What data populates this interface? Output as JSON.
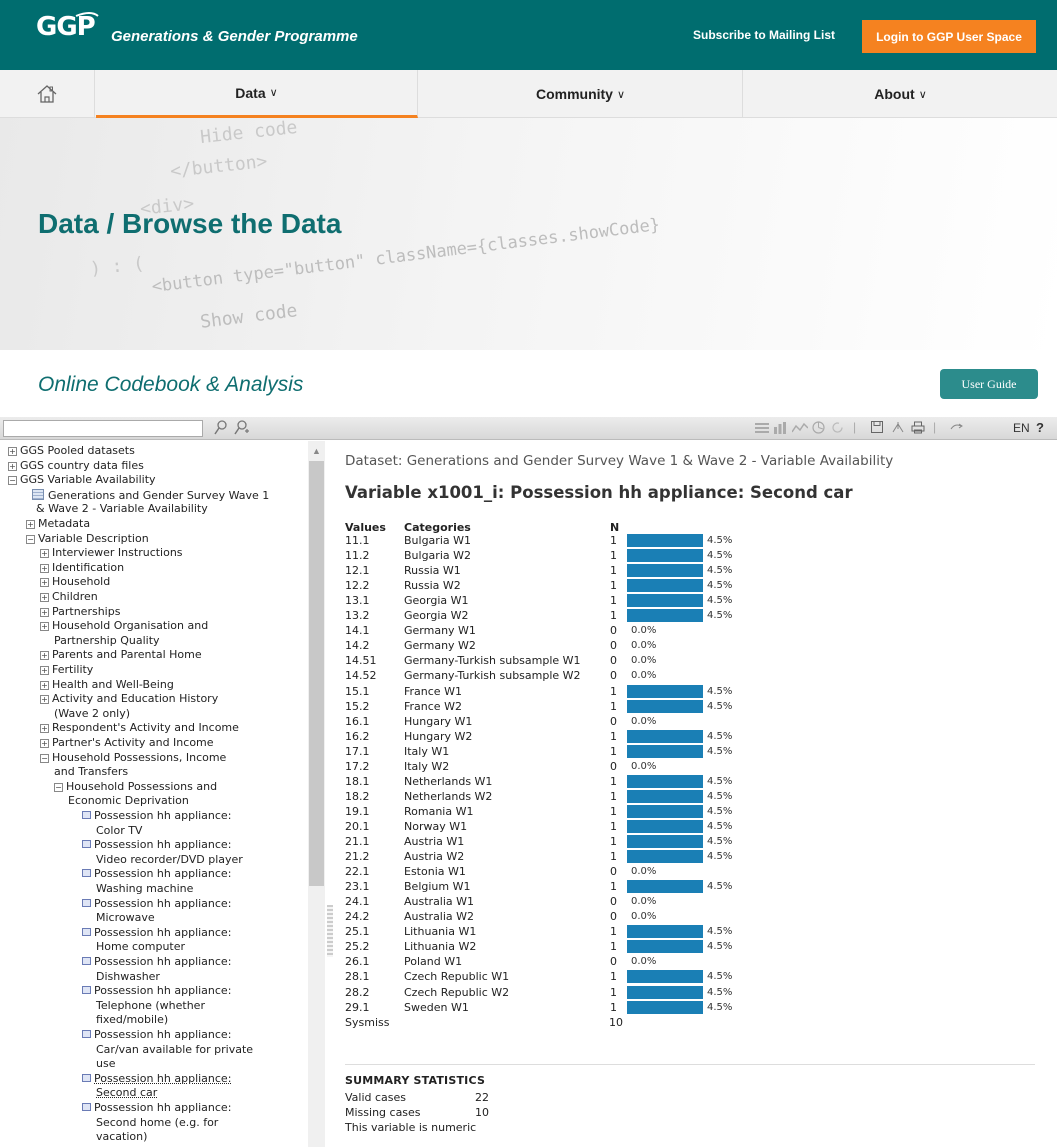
{
  "header": {
    "logo_text": "GGP",
    "brand": "Generations & Gender Programme",
    "subscribe_link": "Subscribe to Mailing List",
    "login_button": "Login to GGP User Space",
    "colors": {
      "teal": "#006d6f",
      "orange": "#f58220"
    }
  },
  "nav": {
    "home_icon": "home-icon",
    "items": [
      {
        "label": "Data",
        "active": true
      },
      {
        "label": "Community",
        "active": false
      },
      {
        "label": "About",
        "active": false
      }
    ],
    "chevron": "∨"
  },
  "hero": {
    "title": "Data / Browse the Data",
    "bg_code": [
      "Hide code",
      "</button>",
      "<div>",
      "<button type=\"button\" className={classes.showCode}",
      "Show code",
      ") : ("
    ]
  },
  "codebook": {
    "title": "Online Codebook & Analysis",
    "user_guide": "User Guide"
  },
  "toolbar": {
    "search_placeholder": "",
    "lang": "EN",
    "help": "?"
  },
  "tree": {
    "expanded_symbol": "−",
    "collapsed_symbol": "+",
    "items": [
      {
        "label": "GGS Pooled datasets",
        "kind": "box",
        "state": "+"
      },
      {
        "label": "GGS country data files",
        "kind": "box",
        "state": "+"
      },
      {
        "label": "GGS Variable Availability",
        "kind": "box",
        "state": "−"
      },
      {
        "label": "Generations and Gender Survey Wave 1",
        "kind": "dataset"
      },
      {
        "label": "& Wave 2 - Variable Availability",
        "kind": "cont"
      },
      {
        "label": "Metadata",
        "kind": "box",
        "state": "+"
      },
      {
        "label": "Variable Description",
        "kind": "box",
        "state": "−"
      },
      {
        "label": "Interviewer Instructions",
        "kind": "box",
        "state": "+"
      },
      {
        "label": "Identification",
        "kind": "box",
        "state": "+"
      },
      {
        "label": "Household",
        "kind": "box",
        "state": "+"
      },
      {
        "label": "Children",
        "kind": "box",
        "state": "+"
      },
      {
        "label": "Partnerships",
        "kind": "box",
        "state": "+"
      },
      {
        "label": "Household Organisation and",
        "kind": "box",
        "state": "+"
      },
      {
        "label": "Partnership Quality",
        "kind": "cont"
      },
      {
        "label": "Parents and Parental Home",
        "kind": "box",
        "state": "+"
      },
      {
        "label": "Fertility",
        "kind": "box",
        "state": "+"
      },
      {
        "label": "Health and Well-Being",
        "kind": "box",
        "state": "+"
      },
      {
        "label": "Activity and Education History",
        "kind": "box",
        "state": "+"
      },
      {
        "label": "(Wave 2 only)",
        "kind": "cont"
      },
      {
        "label": "Respondent's Activity and Income",
        "kind": "box",
        "state": "+"
      },
      {
        "label": "Partner's Activity and Income",
        "kind": "box",
        "state": "+"
      },
      {
        "label": "Household Possessions, Income",
        "kind": "box",
        "state": "−"
      },
      {
        "label": "and Transfers",
        "kind": "cont"
      },
      {
        "label": "Household Possessions and",
        "kind": "box",
        "state": "−"
      },
      {
        "label": "Economic Deprivation",
        "kind": "cont"
      },
      {
        "label": "Possession hh appliance:",
        "kind": "var"
      },
      {
        "label": "Color TV",
        "kind": "cont"
      },
      {
        "label": "Possession hh appliance:",
        "kind": "var"
      },
      {
        "label": "Video recorder/DVD player",
        "kind": "cont"
      },
      {
        "label": "Possession hh appliance:",
        "kind": "var"
      },
      {
        "label": "Washing machine",
        "kind": "cont"
      },
      {
        "label": "Possession hh appliance:",
        "kind": "var"
      },
      {
        "label": "Microwave",
        "kind": "cont"
      },
      {
        "label": "Possession hh appliance:",
        "kind": "var"
      },
      {
        "label": "Home computer",
        "kind": "cont"
      },
      {
        "label": "Possession hh appliance:",
        "kind": "var"
      },
      {
        "label": "Dishwasher",
        "kind": "cont"
      },
      {
        "label": "Possession hh appliance:",
        "kind": "var"
      },
      {
        "label": "Telephone (whether",
        "kind": "cont"
      },
      {
        "label": "fixed/mobile)",
        "kind": "cont"
      },
      {
        "label": "Possession hh appliance:",
        "kind": "var"
      },
      {
        "label": "Car/van available for private",
        "kind": "cont"
      },
      {
        "label": "use",
        "kind": "cont"
      },
      {
        "label": "Possession hh appliance:",
        "kind": "var",
        "current": true
      },
      {
        "label": "Second car",
        "kind": "cont",
        "current": true
      },
      {
        "label": "Possession hh appliance:",
        "kind": "var"
      },
      {
        "label": "Second home (e.g. for",
        "kind": "cont"
      },
      {
        "label": "vacation)",
        "kind": "cont"
      }
    ]
  },
  "main": {
    "dataset_line": "Dataset: Generations and Gender Survey Wave 1 & Wave 2 - Variable Availability",
    "variable_title": "Variable x1001_i: Possession hh appliance: Second car",
    "headers": {
      "values": "Values",
      "categories": "Categories",
      "n": "N"
    },
    "bar_color": "#1a7fb5",
    "rows": [
      {
        "value": "11.1",
        "category": "Bulgaria W1",
        "n": "1",
        "pct": "4.5%",
        "frac": 0.045
      },
      {
        "value": "11.2",
        "category": "Bulgaria W2",
        "n": "1",
        "pct": "4.5%",
        "frac": 0.045
      },
      {
        "value": "12.1",
        "category": "Russia W1",
        "n": "1",
        "pct": "4.5%",
        "frac": 0.045
      },
      {
        "value": "12.2",
        "category": "Russia W2",
        "n": "1",
        "pct": "4.5%",
        "frac": 0.045
      },
      {
        "value": "13.1",
        "category": "Georgia W1",
        "n": "1",
        "pct": "4.5%",
        "frac": 0.045
      },
      {
        "value": "13.2",
        "category": "Georgia W2",
        "n": "1",
        "pct": "4.5%",
        "frac": 0.045
      },
      {
        "value": "14.1",
        "category": "Germany W1",
        "n": "0",
        "pct": "0.0%",
        "frac": 0
      },
      {
        "value": "14.2",
        "category": "Germany W2",
        "n": "0",
        "pct": "0.0%",
        "frac": 0
      },
      {
        "value": "14.51",
        "category": "Germany-Turkish subsample W1",
        "n": "0",
        "pct": "0.0%",
        "frac": 0
      },
      {
        "value": "14.52",
        "category": "Germany-Turkish subsample W2",
        "n": "0",
        "pct": "0.0%",
        "frac": 0
      },
      {
        "value": "15.1",
        "category": "France W1",
        "n": "1",
        "pct": "4.5%",
        "frac": 0.045
      },
      {
        "value": "15.2",
        "category": "France W2",
        "n": "1",
        "pct": "4.5%",
        "frac": 0.045
      },
      {
        "value": "16.1",
        "category": "Hungary W1",
        "n": "0",
        "pct": "0.0%",
        "frac": 0
      },
      {
        "value": "16.2",
        "category": "Hungary W2",
        "n": "1",
        "pct": "4.5%",
        "frac": 0.045
      },
      {
        "value": "17.1",
        "category": "Italy W1",
        "n": "1",
        "pct": "4.5%",
        "frac": 0.045
      },
      {
        "value": "17.2",
        "category": "Italy W2",
        "n": "0",
        "pct": "0.0%",
        "frac": 0
      },
      {
        "value": "18.1",
        "category": "Netherlands W1",
        "n": "1",
        "pct": "4.5%",
        "frac": 0.045
      },
      {
        "value": "18.2",
        "category": "Netherlands W2",
        "n": "1",
        "pct": "4.5%",
        "frac": 0.045
      },
      {
        "value": "19.1",
        "category": "Romania W1",
        "n": "1",
        "pct": "4.5%",
        "frac": 0.045
      },
      {
        "value": "20.1",
        "category": "Norway W1",
        "n": "1",
        "pct": "4.5%",
        "frac": 0.045
      },
      {
        "value": "21.1",
        "category": "Austria W1",
        "n": "1",
        "pct": "4.5%",
        "frac": 0.045
      },
      {
        "value": "21.2",
        "category": "Austria W2",
        "n": "1",
        "pct": "4.5%",
        "frac": 0.045
      },
      {
        "value": "22.1",
        "category": "Estonia W1",
        "n": "0",
        "pct": "0.0%",
        "frac": 0
      },
      {
        "value": "23.1",
        "category": "Belgium W1",
        "n": "1",
        "pct": "4.5%",
        "frac": 0.045
      },
      {
        "value": "24.1",
        "category": "Australia W1",
        "n": "0",
        "pct": "0.0%",
        "frac": 0
      },
      {
        "value": "24.2",
        "category": "Australia W2",
        "n": "0",
        "pct": "0.0%",
        "frac": 0
      },
      {
        "value": "25.1",
        "category": "Lithuania W1",
        "n": "1",
        "pct": "4.5%",
        "frac": 0.045
      },
      {
        "value": "25.2",
        "category": "Lithuania W2",
        "n": "1",
        "pct": "4.5%",
        "frac": 0.045
      },
      {
        "value": "26.1",
        "category": "Poland W1",
        "n": "0",
        "pct": "0.0%",
        "frac": 0
      },
      {
        "value": "28.1",
        "category": "Czech Republic W1",
        "n": "1",
        "pct": "4.5%",
        "frac": 0.045
      },
      {
        "value": "28.2",
        "category": "Czech Republic W2",
        "n": "1",
        "pct": "4.5%",
        "frac": 0.045
      },
      {
        "value": "29.1",
        "category": "Sweden W1",
        "n": "1",
        "pct": "4.5%",
        "frac": 0.045
      },
      {
        "value": "Sysmiss",
        "category": "",
        "n": "10",
        "pct": "",
        "frac": null
      }
    ],
    "summary": {
      "title": "SUMMARY STATISTICS",
      "stats": [
        {
          "label": "Valid cases",
          "value": "22"
        },
        {
          "label": "Missing cases",
          "value": "10"
        },
        {
          "label": "This variable is numeric",
          "value": ""
        }
      ]
    }
  }
}
